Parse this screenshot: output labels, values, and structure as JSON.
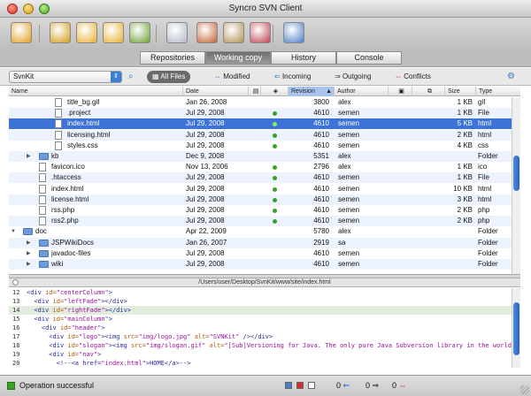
{
  "window": {
    "title": "Syncro SVN Client"
  },
  "toolbar": {
    "buttons": [
      {
        "name": "database-icon",
        "color": "#e0a020"
      },
      {
        "name": "checkout-icon",
        "color": "#d29a18"
      },
      {
        "name": "folder-open-icon",
        "color": "#e8b030"
      },
      {
        "name": "folder-up-icon",
        "color": "#e8b030"
      },
      {
        "name": "folder-refresh-icon",
        "color": "#6aa030"
      },
      {
        "name": "table-icon",
        "color": "#b0b8c8"
      },
      {
        "name": "clock-icon",
        "color": "#c06030"
      },
      {
        "name": "clipboard-icon",
        "color": "#b09050"
      },
      {
        "name": "graph-icon",
        "color": "#c04050"
      },
      {
        "name": "panel-icon",
        "color": "#4a7ec8"
      }
    ]
  },
  "tabs": [
    {
      "label": "Repositories",
      "active": false
    },
    {
      "label": "Working copy",
      "active": true
    },
    {
      "label": "History",
      "active": false
    },
    {
      "label": "Console",
      "active": false
    }
  ],
  "filter": {
    "working_copy": "SvnKit",
    "buttons": [
      {
        "label": "All Files",
        "active": true
      },
      {
        "label": "Modified",
        "active": false
      },
      {
        "label": "Incoming",
        "active": false
      },
      {
        "label": "Outgoing",
        "active": false
      },
      {
        "label": "Conflicts",
        "active": false
      }
    ]
  },
  "columns": [
    "Name",
    "Date",
    "",
    "",
    "Revision",
    "Author",
    "",
    "",
    "Size",
    "Type"
  ],
  "rows": [
    {
      "indent": 2,
      "kind": "file",
      "name": "title_bg.gif",
      "date": "Jan 26, 2008",
      "dot": false,
      "rev": "3800",
      "author": "alex",
      "size": "1 KB",
      "type": "gif"
    },
    {
      "indent": 2,
      "kind": "file",
      "name": ".project",
      "date": "Jul 29, 2008",
      "dot": true,
      "rev": "4610",
      "author": "semen",
      "size": "1 KB",
      "type": "File"
    },
    {
      "indent": 2,
      "kind": "file",
      "name": "index.html",
      "date": "Jul 29, 2008",
      "dot": true,
      "rev": "4610",
      "author": "semen",
      "size": "5 KB",
      "type": "html",
      "selected": true
    },
    {
      "indent": 2,
      "kind": "file",
      "name": "licensing.html",
      "date": "Jul 29, 2008",
      "dot": true,
      "rev": "4610",
      "author": "semen",
      "size": "2 KB",
      "type": "html"
    },
    {
      "indent": 2,
      "kind": "file",
      "name": "styles.css",
      "date": "Jul 29, 2008",
      "dot": true,
      "rev": "4610",
      "author": "semen",
      "size": "4 KB",
      "type": "css"
    },
    {
      "indent": 1,
      "kind": "folder",
      "name": "kb",
      "date": "Dec 9, 2008",
      "dot": false,
      "rev": "5351",
      "author": "alex",
      "size": "",
      "type": "Folder",
      "tri": "▶"
    },
    {
      "indent": 1,
      "kind": "file",
      "name": "favicon.ico",
      "date": "Nov 13, 2006",
      "dot": true,
      "rev": "2796",
      "author": "alex",
      "size": "1 KB",
      "type": "ico"
    },
    {
      "indent": 1,
      "kind": "file",
      "name": ".htaccess",
      "date": "Jul 29, 2008",
      "dot": true,
      "rev": "4610",
      "author": "semen",
      "size": "1 KB",
      "type": "File"
    },
    {
      "indent": 1,
      "kind": "file",
      "name": "index.html",
      "date": "Jul 29, 2008",
      "dot": true,
      "rev": "4610",
      "author": "semen",
      "size": "10 KB",
      "type": "html"
    },
    {
      "indent": 1,
      "kind": "file",
      "name": "license.html",
      "date": "Jul 29, 2008",
      "dot": true,
      "rev": "4610",
      "author": "semen",
      "size": "3 KB",
      "type": "html"
    },
    {
      "indent": 1,
      "kind": "file",
      "name": "rss.php",
      "date": "Jul 29, 2008",
      "dot": true,
      "rev": "4610",
      "author": "semen",
      "size": "2 KB",
      "type": "php"
    },
    {
      "indent": 1,
      "kind": "file",
      "name": "rss2.php",
      "date": "Jul 29, 2008",
      "dot": true,
      "rev": "4610",
      "author": "semen",
      "size": "2 KB",
      "type": "php"
    },
    {
      "indent": 0,
      "kind": "folder",
      "name": "doc",
      "date": "Apr 22, 2009",
      "dot": false,
      "rev": "5780",
      "author": "alex",
      "size": "",
      "type": "Folder",
      "tri": "▼"
    },
    {
      "indent": 1,
      "kind": "folder",
      "name": "JSPWikiDocs",
      "date": "Jan 26, 2007",
      "dot": false,
      "rev": "2919",
      "author": "sa",
      "size": "",
      "type": "Folder",
      "tri": "▶"
    },
    {
      "indent": 1,
      "kind": "folder",
      "name": "javadoc-files",
      "date": "Jul 29, 2008",
      "dot": false,
      "rev": "4610",
      "author": "semen",
      "size": "",
      "type": "Folder",
      "tri": "▶"
    },
    {
      "indent": 1,
      "kind": "folder",
      "name": "wiki",
      "date": "Jul 29, 2008",
      "dot": false,
      "rev": "4610",
      "author": "semen",
      "size": "",
      "type": "Folder",
      "tri": "▶"
    }
  ],
  "path": "/Users/user/Desktop/SvnKit/www/site/index.html",
  "code": [
    {
      "num": "12",
      "html": "<span class='tag'>&lt;div</span> <span class='attr'>id=</span><span class='val'>\"centerColumn\"</span><span class='tag'>&gt;</span>"
    },
    {
      "num": "13",
      "html": "  <span class='tag'>&lt;div</span> <span class='attr'>id=</span><span class='val'>\"leftFade\"</span><span class='tag'>&gt;&lt;/div&gt;</span>"
    },
    {
      "num": "14",
      "hl": true,
      "html": "  <span class='tag'>&lt;div</span> <span class='attr'>id=</span><span class='val'>\"rightFade\"</span><span class='tag'>&gt;&lt;/div&gt;</span>"
    },
    {
      "num": "15",
      "html": "  <span class='tag'>&lt;div</span> <span class='attr'>id=</span><span class='val'>\"mainColumn\"</span><span class='tag'>&gt;</span>"
    },
    {
      "num": "16",
      "html": "    <span class='tag'>&lt;div</span> <span class='attr'>id=</span><span class='val'>\"header\"</span><span class='tag'>&gt;</span>"
    },
    {
      "num": "17",
      "html": "      <span class='tag'>&lt;div</span> <span class='attr'>id=</span><span class='val'>\"logo\"</span><span class='tag'>&gt;&lt;img</span> <span class='attr'>src=</span><span class='val'>\"img/logo.jpg\"</span> <span class='attr'>alt=</span><span class='val'>\"SVNKit\"</span> <span class='tag'>/&gt;&lt;/div&gt;</span>"
    },
    {
      "num": "18",
      "html": "      <span class='tag'>&lt;div</span> <span class='attr'>id=</span><span class='val'>\"slogan\"</span><span class='tag'>&gt;&lt;img</span> <span class='attr'>src=</span><span class='val'>\"img/slogan.gif\"</span> <span class='attr'>alt=</span><span class='val'>\"[Sub]Versioning for Java. The only pure Java Subversion library in the world!\"</span> <span class='tag'>/&gt;&lt;/div&gt;</span>"
    },
    {
      "num": "19",
      "html": "      <span class='tag'>&lt;div</span> <span class='attr'>id=</span><span class='val'>\"nav\"</span><span class='tag'>&gt;</span>"
    },
    {
      "num": "20",
      "html": "        <span class='tag'>&lt;!--&lt;a href=</span><span class='val'>\"index.html\"</span><span class='tag'>&gt;HOME&lt;/a&gt;--&gt;</span>"
    }
  ],
  "status": {
    "message": "Operation successful",
    "incoming": "0",
    "outgoing": "0",
    "conflicts": "0"
  }
}
